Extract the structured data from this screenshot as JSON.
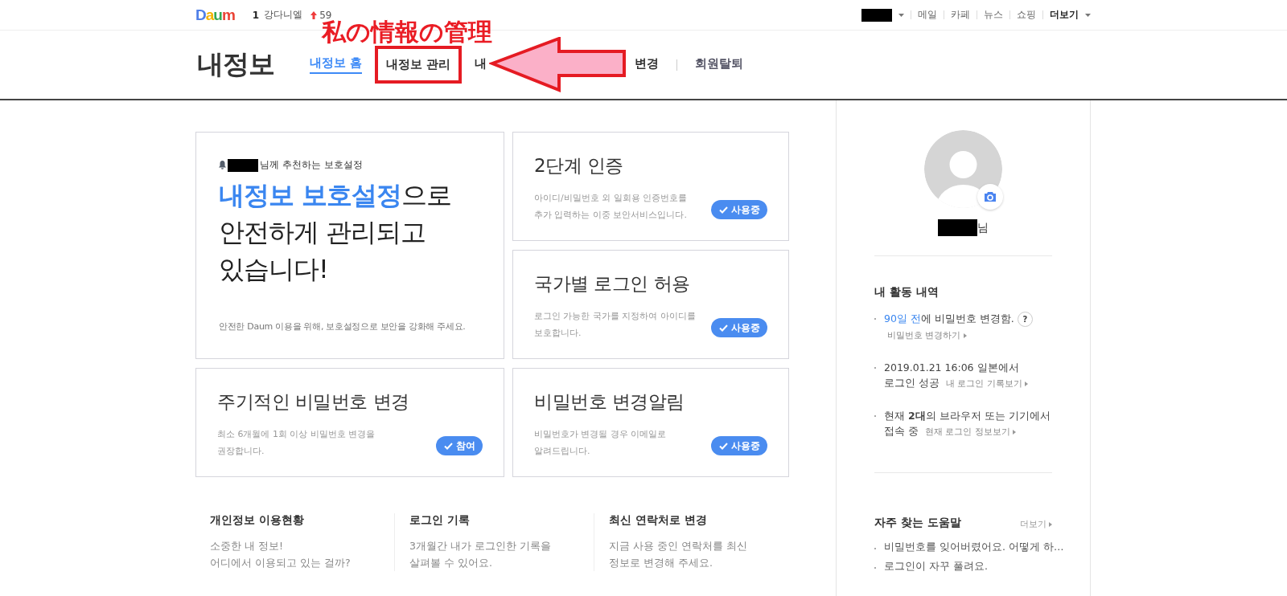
{
  "top_bar": {
    "logo": "Daum",
    "rank": "1",
    "keyword": "강다니엘",
    "trend_value": "59",
    "account_redacted": true,
    "links": [
      {
        "label": "메일"
      },
      {
        "label": "카페"
      },
      {
        "label": "뉴스"
      },
      {
        "label": "쇼핑"
      }
    ],
    "more": "더보기"
  },
  "header": {
    "title": "내정보",
    "tabs": [
      {
        "label": "내정보 홈",
        "selected": true,
        "boxed": false
      },
      {
        "label": "내정보 관리",
        "selected": false,
        "boxed": true
      },
      {
        "label": "내",
        "selected": false,
        "boxed": false
      },
      {
        "label": "변경",
        "selected": false,
        "boxed": false
      },
      {
        "label": "회원탈퇴",
        "selected": false,
        "boxed": false
      }
    ]
  },
  "annotation": {
    "text": "私の情報の管理"
  },
  "feature_card": {
    "notice": "님께 추천하는 보호설정",
    "headline_accent": "내정보 보호설정",
    "headline_lines": [
      "으로",
      "안전하게 관리되고",
      "있습니다!"
    ],
    "note": "안전한 Daum 이용을 위해, 보호설정으로 보안을 강화해 주세요."
  },
  "setting_cards": [
    {
      "title": "2단계 인증",
      "description_lines": [
        "아이디/비밀번호 외 일회용 인증번호를",
        "추가 입력하는 이중 보안서비스입니다."
      ],
      "badge": "사용중"
    },
    {
      "title": "국가별 로그인 허용",
      "description_lines": [
        "로그인 가능한 국가를 지정하여 아이디를",
        "보호합니다."
      ],
      "badge": "사용중"
    },
    {
      "title": "주기적인 비밀번호 변경",
      "description_lines": [
        "최소 6개월에 1회 이상 비밀번호 변경을",
        "권장합니다."
      ],
      "badge": "참여"
    },
    {
      "title": "비밀번호 변경알림",
      "description_lines": [
        "비밀번호가 변경될 경우 이메일로",
        "알려드립니다."
      ],
      "badge": "사용중"
    }
  ],
  "info_columns": [
    {
      "title": "개인정보 이용현황",
      "lines": [
        "소중한 내 정보!",
        "어디에서 이용되고 있는 걸까?"
      ]
    },
    {
      "title": "로그인 기록",
      "lines": [
        "3개월간 내가 로그인한 기록을",
        "살펴볼 수 있어요."
      ]
    },
    {
      "title": "최신 연락처로 변경",
      "lines": [
        "지금 사용 중인 연락처를 최신",
        "정보로 변경해 주세요."
      ]
    }
  ],
  "profile": {
    "name_suffix": "님"
  },
  "activity": {
    "title": "내 활동 내역",
    "items": [
      {
        "accent": "90일 전",
        "text": "에 비밀번호 변경함.",
        "help": "?",
        "link": "비밀번호 변경하기"
      },
      {
        "text": "2019.01.21 16:06 일본에서 로그인 성공",
        "link": "내 로그인 기록보기"
      },
      {
        "text": "현재 **2대**의 브라우저 또는 기기에서 접속 중",
        "link": "현재 로그인 정보보기"
      }
    ]
  },
  "help": {
    "title": "자주 찾는 도움말",
    "more": "더보기",
    "items": [
      "비밀번호를 잊어버렸어요. 어떻게 하…",
      "로그인이 자꾸 풀려요."
    ]
  }
}
